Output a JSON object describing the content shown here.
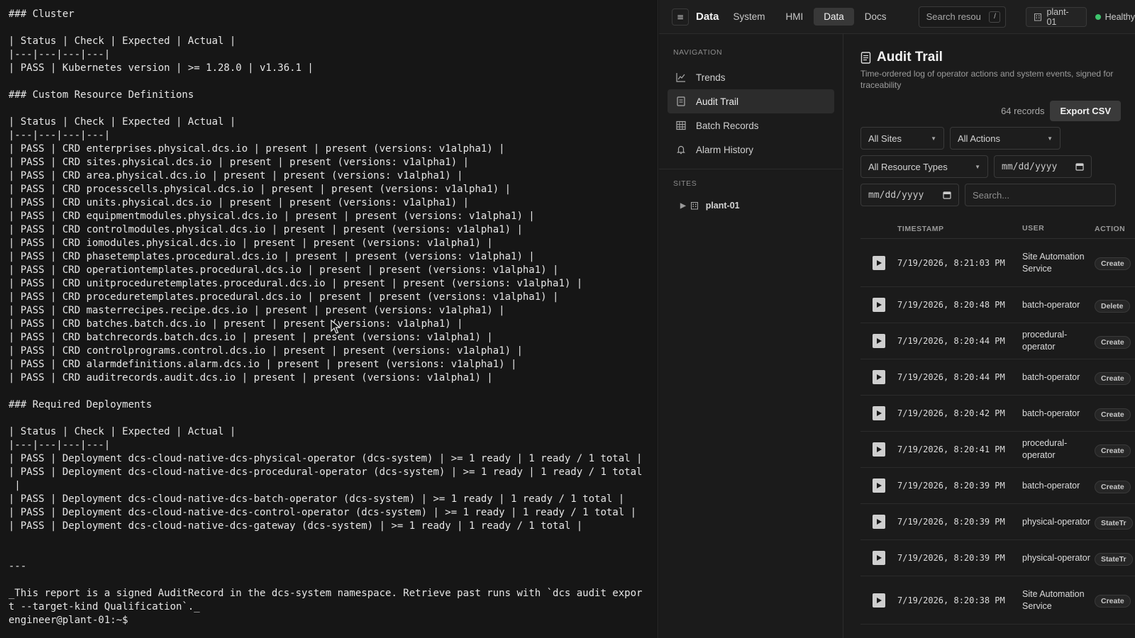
{
  "terminal": {
    "lines": [
      "### Cluster",
      "",
      "| Status | Check | Expected | Actual |",
      "|---|---|---|---|",
      "| PASS | Kubernetes version | >= 1.28.0 | v1.36.1 |",
      "",
      "### Custom Resource Definitions",
      "",
      "| Status | Check | Expected | Actual |",
      "|---|---|---|---|",
      "| PASS | CRD enterprises.physical.dcs.io | present | present (versions: v1alpha1) |",
      "| PASS | CRD sites.physical.dcs.io | present | present (versions: v1alpha1) |",
      "| PASS | CRD area.physical.dcs.io | present | present (versions: v1alpha1) |",
      "| PASS | CRD processcells.physical.dcs.io | present | present (versions: v1alpha1) |",
      "| PASS | CRD units.physical.dcs.io | present | present (versions: v1alpha1) |",
      "| PASS | CRD equipmentmodules.physical.dcs.io | present | present (versions: v1alpha1) |",
      "| PASS | CRD controlmodules.physical.dcs.io | present | present (versions: v1alpha1) |",
      "| PASS | CRD iomodules.physical.dcs.io | present | present (versions: v1alpha1) |",
      "| PASS | CRD phasetemplates.procedural.dcs.io | present | present (versions: v1alpha1) |",
      "| PASS | CRD operationtemplates.procedural.dcs.io | present | present (versions: v1alpha1) |",
      "| PASS | CRD unitproceduretemplates.procedural.dcs.io | present | present (versions: v1alpha1) |",
      "| PASS | CRD proceduretemplates.procedural.dcs.io | present | present (versions: v1alpha1) |",
      "| PASS | CRD masterrecipes.recipe.dcs.io | present | present (versions: v1alpha1) |",
      "| PASS | CRD batches.batch.dcs.io | present | present (versions: v1alpha1) |",
      "| PASS | CRD batchrecords.batch.dcs.io | present | present (versions: v1alpha1) |",
      "| PASS | CRD controlprograms.control.dcs.io | present | present (versions: v1alpha1) |",
      "| PASS | CRD alarmdefinitions.alarm.dcs.io | present | present (versions: v1alpha1) |",
      "| PASS | CRD auditrecords.audit.dcs.io | present | present (versions: v1alpha1) |",
      "",
      "### Required Deployments",
      "",
      "| Status | Check | Expected | Actual |",
      "|---|---|---|---|",
      "| PASS | Deployment dcs-cloud-native-dcs-physical-operator (dcs-system) | >= 1 ready | 1 ready / 1 total |",
      "| PASS | Deployment dcs-cloud-native-dcs-procedural-operator (dcs-system) | >= 1 ready | 1 ready / 1 total",
      " |",
      "| PASS | Deployment dcs-cloud-native-dcs-batch-operator (dcs-system) | >= 1 ready | 1 ready / 1 total |",
      "| PASS | Deployment dcs-cloud-native-dcs-control-operator (dcs-system) | >= 1 ready | 1 ready / 1 total |",
      "| PASS | Deployment dcs-cloud-native-dcs-gateway (dcs-system) | >= 1 ready | 1 ready / 1 total |",
      "",
      "",
      "---",
      "",
      "_This report is a signed AuditRecord in the dcs-system namespace. Retrieve past runs with `dcs audit expor",
      "t --target-kind Qualification`._",
      "engineer@plant-01:~$ "
    ]
  },
  "topbar": {
    "menu_icon": "hamburger-icon",
    "title": "Data",
    "tabs": [
      {
        "label": "System",
        "active": false
      },
      {
        "label": "HMI",
        "active": false
      },
      {
        "label": "Data",
        "active": true
      },
      {
        "label": "Docs",
        "active": false
      }
    ],
    "search_placeholder": "Search resou",
    "search_shortcut": "/",
    "site": "plant-01",
    "health": "Healthy",
    "health_color": "#3ec46d"
  },
  "sidebar": {
    "nav_heading": "NAVIGATION",
    "items": [
      {
        "label": "Trends",
        "icon": "trend-chart-icon",
        "active": false
      },
      {
        "label": "Audit Trail",
        "icon": "document-icon",
        "active": true
      },
      {
        "label": "Batch Records",
        "icon": "grid-table-icon",
        "active": false
      },
      {
        "label": "Alarm History",
        "icon": "bell-icon",
        "active": false
      }
    ],
    "sites_heading": "SITES",
    "sites": [
      {
        "label": "plant-01",
        "icon": "building-icon"
      }
    ]
  },
  "main": {
    "title": "Audit Trail",
    "subtitle": "Time-ordered log of operator actions and system events, signed for traceability",
    "record_count": "64 records",
    "export_label": "Export CSV",
    "filters": {
      "sites": "All Sites",
      "actions": "All Actions",
      "resource_types": "All Resource Types",
      "date_from": "mm/dd/yyyy",
      "date_to": "mm/dd/yyyy",
      "search_placeholder": "Search..."
    },
    "columns": [
      "TIMESTAMP",
      "USER",
      "ACTION"
    ],
    "rows": [
      {
        "timestamp": "7/19/2026, 8:21:03 PM",
        "user": "Site Automation Service",
        "action": "Create"
      },
      {
        "timestamp": "7/19/2026, 8:20:48 PM",
        "user": "batch-operator",
        "action": "Delete"
      },
      {
        "timestamp": "7/19/2026, 8:20:44 PM",
        "user": "procedural-operator",
        "action": "Create"
      },
      {
        "timestamp": "7/19/2026, 8:20:44 PM",
        "user": "batch-operator",
        "action": "Create"
      },
      {
        "timestamp": "7/19/2026, 8:20:42 PM",
        "user": "batch-operator",
        "action": "Create"
      },
      {
        "timestamp": "7/19/2026, 8:20:41 PM",
        "user": "procedural-operator",
        "action": "Create"
      },
      {
        "timestamp": "7/19/2026, 8:20:39 PM",
        "user": "batch-operator",
        "action": "Create"
      },
      {
        "timestamp": "7/19/2026, 8:20:39 PM",
        "user": "physical-operator",
        "action": "StateTr"
      },
      {
        "timestamp": "7/19/2026, 8:20:39 PM",
        "user": "physical-operator",
        "action": "StateTr"
      },
      {
        "timestamp": "7/19/2026, 8:20:38 PM",
        "user": "Site Automation Service",
        "action": "Create"
      }
    ]
  }
}
